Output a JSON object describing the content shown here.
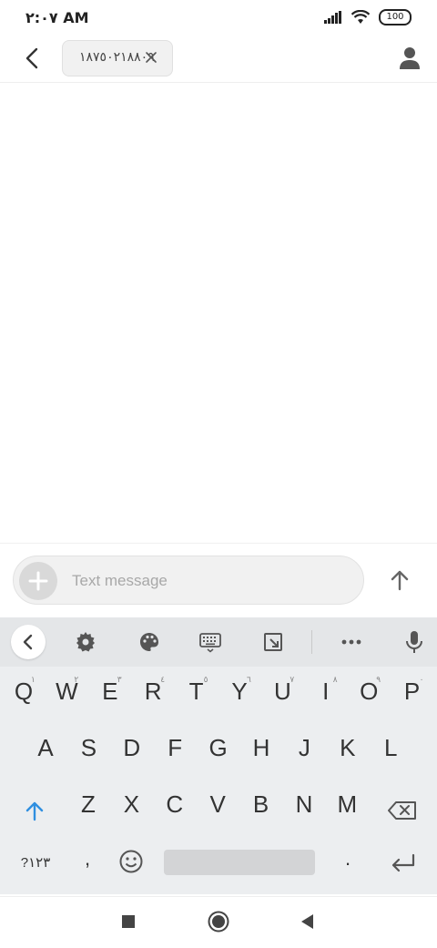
{
  "status_bar": {
    "time": "٢:٠٧ AM",
    "battery": "100",
    "icons": [
      "signal-icon",
      "wifi-icon",
      "battery-icon"
    ]
  },
  "header": {
    "back_icon": "back-arrow-icon",
    "recipient_chip": "١٨٧٥٠٢١٨٨٠٩",
    "chip_close_icon": "close-icon",
    "contact_icon": "person-icon"
  },
  "compose": {
    "placeholder": "Text message",
    "add_icon": "plus-icon",
    "send_icon": "send-arrow-icon"
  },
  "keyboard": {
    "toolbar_icons": [
      "chevron-left-icon",
      "gear-icon",
      "palette-icon",
      "keyboard-icon",
      "resize-icon",
      "more-icon",
      "mic-icon"
    ],
    "row1": [
      "Q",
      "W",
      "E",
      "R",
      "T",
      "Y",
      "U",
      "I",
      "O",
      "P"
    ],
    "row1_hints": [
      "١",
      "٢",
      "٣",
      "٤",
      "٥",
      "٦",
      "٧",
      "٨",
      "٩",
      "٠"
    ],
    "row2": [
      "A",
      "S",
      "D",
      "F",
      "G",
      "H",
      "J",
      "K",
      "L"
    ],
    "row3": [
      "Z",
      "X",
      "C",
      "V",
      "B",
      "N",
      "M"
    ],
    "symbols_key": "?١٢٣",
    "comma_key": ",",
    "period_key": "."
  },
  "colors": {
    "accent": "#2f8fe0",
    "keyboard_bg": "#eceef0",
    "toolbar_bg": "#e4e6e8"
  }
}
